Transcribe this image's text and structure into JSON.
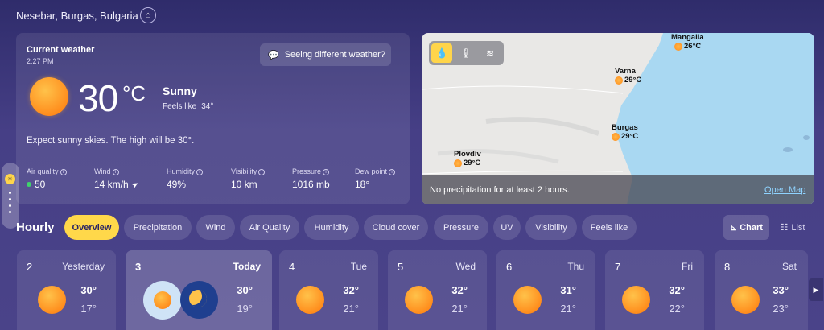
{
  "header": {
    "location": "Nesebar, Burgas, Bulgaria",
    "home_icon": "home-icon"
  },
  "current": {
    "title": "Current weather",
    "time": "2:27 PM",
    "seeing_label": "Seeing different weather?",
    "temperature": "30",
    "unit": "°C",
    "condition": "Sunny",
    "feels_label": "Feels like",
    "feels_value": "34°",
    "summary": "Expect sunny skies. The high will be 30°.",
    "stats": [
      {
        "label": "Air quality",
        "value": "50"
      },
      {
        "label": "Wind",
        "value": "14 km/h"
      },
      {
        "label": "Humidity",
        "value": "49%"
      },
      {
        "label": "Visibility",
        "value": "10 km"
      },
      {
        "label": "Pressure",
        "value": "1016 mb"
      },
      {
        "label": "Dew point",
        "value": "18°"
      }
    ]
  },
  "map": {
    "cities": [
      {
        "name": "Mangalia",
        "temp": "26°C"
      },
      {
        "name": "Varna",
        "temp": "29°C"
      },
      {
        "name": "Burgas",
        "temp": "29°C"
      },
      {
        "name": "Plovdiv",
        "temp": "29°C"
      }
    ],
    "precip_note": "No precipitation for at least 2 hours.",
    "open_map": "Open Map",
    "colors": {
      "sea": "#a8d8f0",
      "land": "#e9e8e6",
      "accent": "#ffd54a"
    }
  },
  "hourly": {
    "title": "Hourly",
    "tabs": [
      "Overview",
      "Precipitation",
      "Wind",
      "Air Quality",
      "Humidity",
      "Cloud cover",
      "Pressure",
      "UV",
      "Visibility",
      "Feels like"
    ],
    "chart_label": "Chart",
    "list_label": "List"
  },
  "days": [
    {
      "num": "2",
      "name": "Yesterday",
      "hi": "30°",
      "lo": "17°"
    },
    {
      "num": "3",
      "name": "Today",
      "hi": "30°",
      "lo": "19°"
    },
    {
      "num": "4",
      "name": "Tue",
      "hi": "32°",
      "lo": "21°"
    },
    {
      "num": "5",
      "name": "Wed",
      "hi": "32°",
      "lo": "21°"
    },
    {
      "num": "6",
      "name": "Thu",
      "hi": "31°",
      "lo": "21°"
    },
    {
      "num": "7",
      "name": "Fri",
      "hi": "32°",
      "lo": "22°"
    },
    {
      "num": "8",
      "name": "Sat",
      "hi": "33°",
      "lo": "23°"
    }
  ]
}
